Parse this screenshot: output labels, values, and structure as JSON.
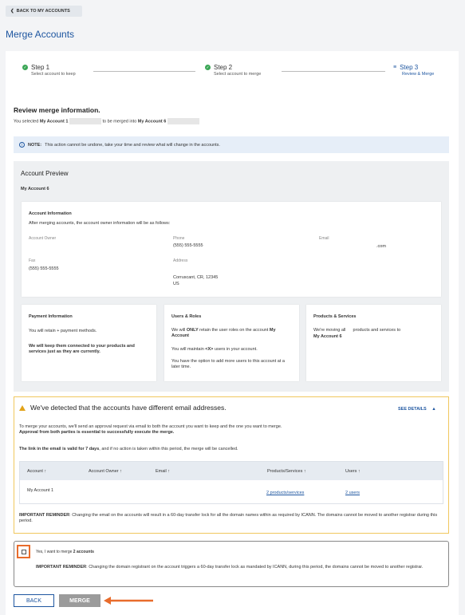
{
  "header": {
    "back_label": "BACK TO MY ACCOUNTS",
    "title": "Merge Accounts"
  },
  "steps": [
    {
      "title": "Step 1",
      "subtitle": "Select account to keep",
      "status": "complete"
    },
    {
      "title": "Step 2",
      "subtitle": "Select account  to merge",
      "status": "complete"
    },
    {
      "title": "Step 3",
      "subtitle": "Review & Merge",
      "status": "current"
    }
  ],
  "review": {
    "title": "Review merge information.",
    "prefix": "You selected",
    "account1": "My Account 1",
    "middle": "to be merged into",
    "account6": "My Account 6"
  },
  "note": {
    "label": "NOTE:",
    "text": "This action cannot be undone, take your time and review what will change in the accounts."
  },
  "preview": {
    "title": "Account Preview",
    "account_name": "My Account 6",
    "account_info": {
      "title": "Account Information",
      "desc": "After merging accounts, the account owner information will be as follows:",
      "owner_label": "Account Owner",
      "phone_label": "Phone",
      "phone": "(555) 555-5555",
      "email_label": "Email",
      "email": ".com",
      "fax_label": "Fax",
      "fax": "(555) 555-5555",
      "address_label": "Address",
      "address1": "Corruscant, CR, 12345",
      "address2": "US"
    },
    "payment": {
      "title": "Payment Information",
      "line1": "You will retain   + payment methods.",
      "line2": "We will keep them connected to your products and services just as they are currently."
    },
    "users": {
      "title": "Users & Roles",
      "l1a": "We will ",
      "l1b": "ONLY",
      "l1c": " retain the user roles on the account ",
      "l1d": "My Account",
      "l2a": "You will maintain ",
      "l2b": "<X>",
      "l2c": " users in your account.",
      "l3": "You have the option to add more users to this account at a later time."
    },
    "products": {
      "title": "Products & Services",
      "l1": "We're moving all      products and services to",
      "l2": "My Account 6"
    }
  },
  "warning": {
    "title": "We've detected that the accounts have different email addresses.",
    "see_details": "SEE DETAILS",
    "p1": "To merge your accounts, we'll send an approval request via email to both the account you want to keep and the one you want to merge.",
    "p1b": "Approval from both parties is essential to successfully execute the merge.",
    "p2a": "The link in the email is valid for 7 days",
    "p2b": ", and if no action is taken within this period, the merge will be cancelled.",
    "table": {
      "headers": [
        "Account",
        "Account Owner",
        "Email",
        "Products/Services",
        "Users"
      ],
      "row": {
        "account": "My Account 1",
        "products": "2 products/services",
        "users": "2 users"
      }
    },
    "reminder_label": "IMPORTANT REMINDER",
    "reminder": ": Changing the email on the accounts will result in a 60-day transfer lock for all the domain names within as required by ICANN. The domains cannot be moved to another registrar during this period."
  },
  "confirm": {
    "label_a": "Yes, I want to merge ",
    "label_b": "2 accounts",
    "reminder_label": "IMPORTANT REMINDER",
    "reminder": ": Changing the domain registrant on the account triggers a 60-day transfer lock as mandated by ICANN, during this period, the domains cannot be moved to another registrar."
  },
  "buttons": {
    "back": "BACK",
    "merge": "MERGE"
  },
  "colors": {
    "accent": "#1e56a0",
    "success": "#3aa655",
    "warning": "#f0c75e",
    "highlight": "#e86c2c"
  }
}
